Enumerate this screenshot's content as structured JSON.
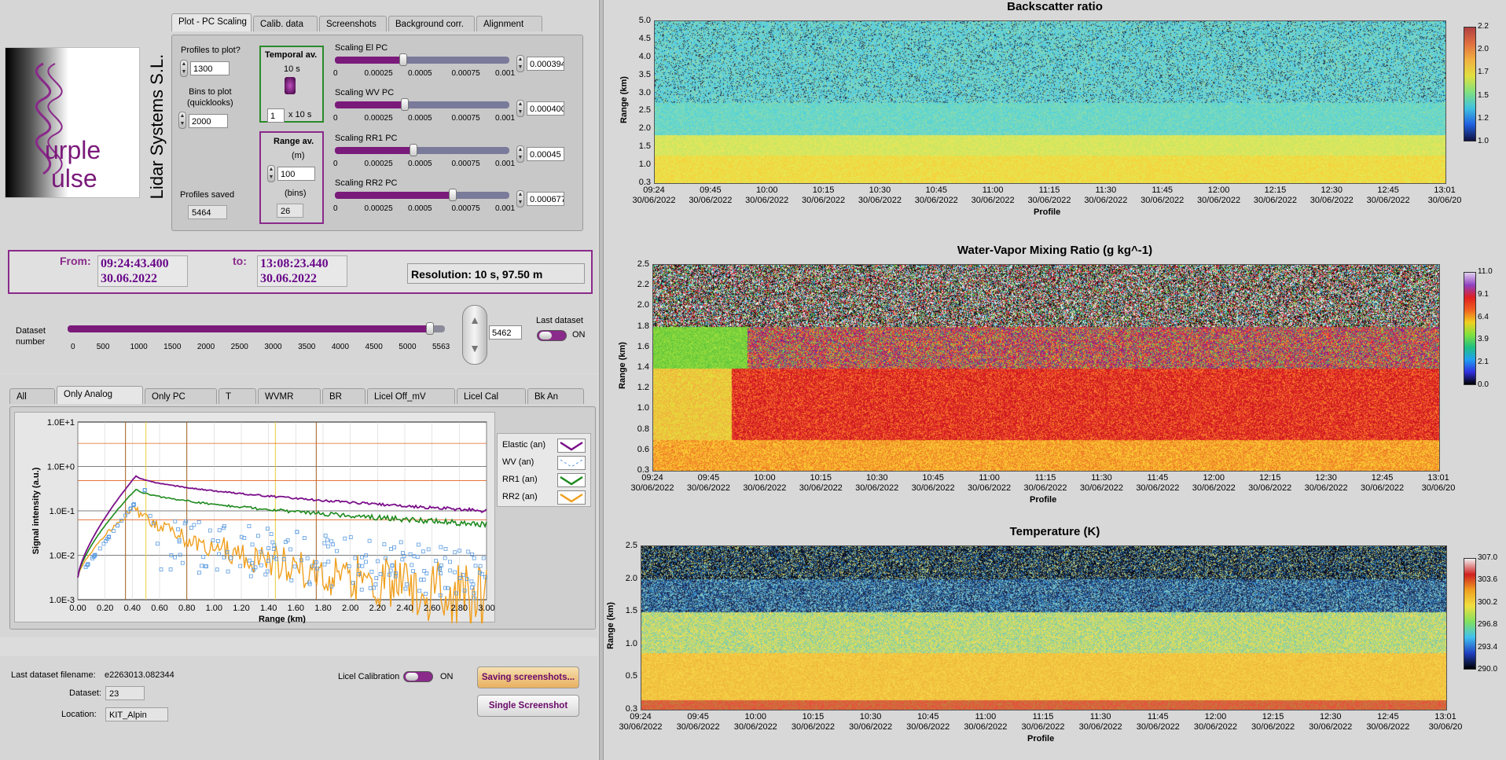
{
  "logo": {
    "line1": "urple",
    "line2": "ulse",
    "company": "Lidar Systems S.L."
  },
  "top_tabs": [
    "Plot - PC Scaling",
    "Calib. data",
    "Screenshots",
    "Background corr.",
    "Alignment"
  ],
  "controls": {
    "profiles_to_plot_label": "Profiles to plot?",
    "profiles_to_plot": "1300",
    "bins_label": "Bins to plot (quicklooks)",
    "bins": "2000",
    "profiles_saved_label": "Profiles saved",
    "profiles_saved": "5464",
    "temporal_av_label": "Temporal av.",
    "temporal_av_value": "10 s",
    "temporal_av_count": "1",
    "temporal_av_unit": "x 10 s",
    "range_av_label": "Range av.",
    "range_av_unit_m": "(m)",
    "range_av_m": "100",
    "range_av_unit_bins": "(bins)",
    "range_av_bins": "26",
    "scalings": [
      {
        "label": "Scaling El PC",
        "value": "0.000394",
        "fraction": 0.394
      },
      {
        "label": "Scaling WV PC",
        "value": "0.000400",
        "fraction": 0.4
      },
      {
        "label": "Scaling RR1 PC",
        "value": "0.00045",
        "fraction": 0.45
      },
      {
        "label": "Scaling RR2 PC",
        "value": "0.000677",
        "fraction": 0.677
      }
    ],
    "scaling_ticks": [
      "0",
      "0.00025",
      "0.0005",
      "0.00075",
      "0.001"
    ]
  },
  "time_range": {
    "from_label": "From:",
    "from_time": "09:24:43.400",
    "from_date": "30.06.2022",
    "to_label": "to:",
    "to_time": "13:08:23.440",
    "to_date": "30.06.2022",
    "resolution": "Resolution: 10 s, 97.50 m"
  },
  "dataset": {
    "label": "Dataset number",
    "value": "5462",
    "fraction": 0.981,
    "ticks": [
      "0",
      "500",
      "1000",
      "1500",
      "2000",
      "2500",
      "3000",
      "3500",
      "4000",
      "4500",
      "5000",
      "5563"
    ],
    "last_dataset_label": "Last dataset",
    "last_dataset_state": "ON"
  },
  "signal_tabs": [
    "All",
    "Only Analog",
    "Only PC",
    "T",
    "WVMR",
    "BR",
    "Licel Off_mV",
    "Licel Cal",
    "Bk An"
  ],
  "signal_plot": {
    "ylabel": "Signal intensity (a.u.)",
    "xlabel": "Range (km)",
    "yticks": [
      "1.0E+1",
      "1.0E+0",
      "1.0E-1",
      "1.0E-2",
      "1.0E-3"
    ],
    "xticks": [
      "0.00",
      "0.20",
      "0.40",
      "0.60",
      "0.80",
      "1.00",
      "1.20",
      "1.40",
      "1.60",
      "1.80",
      "2.00",
      "2.20",
      "2.40",
      "2.60",
      "2.80",
      "3.00"
    ],
    "legend": [
      {
        "name": "Elastic (an)",
        "color": "#7b0f8a"
      },
      {
        "name": "WV (an)",
        "color": "#5a9be0"
      },
      {
        "name": "RR1 (an)",
        "color": "#1e8a1e"
      },
      {
        "name": "RR2 (an)",
        "color": "#f0a020"
      }
    ]
  },
  "footer": {
    "filename_label": "Last dataset filename:",
    "filename": "e2263013.082344",
    "dataset_label": "Dataset:",
    "dataset": "23",
    "location_label": "Location:",
    "location": "KIT_Alpin",
    "licel_label": "Licel Calibration",
    "licel_state": "ON",
    "saving_button": "Saving screenshots...",
    "single_button": "Single Screenshot"
  },
  "plots": [
    {
      "title": "Backscatter ratio",
      "ylabel": "Range (km)",
      "xlabel": "Profile",
      "yticks": [
        "5.0",
        "4.5",
        "4.0",
        "3.5",
        "3.0",
        "2.5",
        "2.0",
        "1.5",
        "1.0",
        "0.3"
      ],
      "colorbar_ticks": [
        "2.2",
        "2.0",
        "1.7",
        "1.5",
        "1.2",
        "1.0"
      ]
    },
    {
      "title": "Water-Vapor Mixing Ratio  (g kg^-1)",
      "ylabel": "Range (km)",
      "xlabel": "Profile",
      "yticks": [
        "2.5",
        "2.2",
        "2.0",
        "1.8",
        "1.6",
        "1.4",
        "1.2",
        "1.0",
        "0.8",
        "0.6",
        "0.3"
      ],
      "colorbar_ticks": [
        "11.0",
        "9.1",
        "6.4",
        "3.9",
        "2.1",
        "0.0"
      ]
    },
    {
      "title": "Temperature (K)",
      "ylabel": "Range (km)",
      "xlabel": "Profile",
      "yticks": [
        "2.5",
        "2.0",
        "1.5",
        "1.0",
        "0.5",
        "0.3"
      ],
      "colorbar_ticks": [
        "307.0",
        "303.6",
        "300.2",
        "296.8",
        "293.4",
        "290.0"
      ]
    }
  ],
  "time_ticks": [
    {
      "t": "09:24",
      "d": "30/06/2022"
    },
    {
      "t": "09:45",
      "d": "30/06/2022"
    },
    {
      "t": "10:00",
      "d": "30/06/2022"
    },
    {
      "t": "10:15",
      "d": "30/06/2022"
    },
    {
      "t": "10:30",
      "d": "30/06/2022"
    },
    {
      "t": "10:45",
      "d": "30/06/2022"
    },
    {
      "t": "11:00",
      "d": "30/06/2022"
    },
    {
      "t": "11:15",
      "d": "30/06/2022"
    },
    {
      "t": "11:30",
      "d": "30/06/2022"
    },
    {
      "t": "11:45",
      "d": "30/06/2022"
    },
    {
      "t": "12:00",
      "d": "30/06/2022"
    },
    {
      "t": "12:15",
      "d": "30/06/2022"
    },
    {
      "t": "12:30",
      "d": "30/06/2022"
    },
    {
      "t": "12:45",
      "d": "30/06/2022"
    },
    {
      "t": "13:01",
      "d": "30/06/20"
    }
  ]
}
